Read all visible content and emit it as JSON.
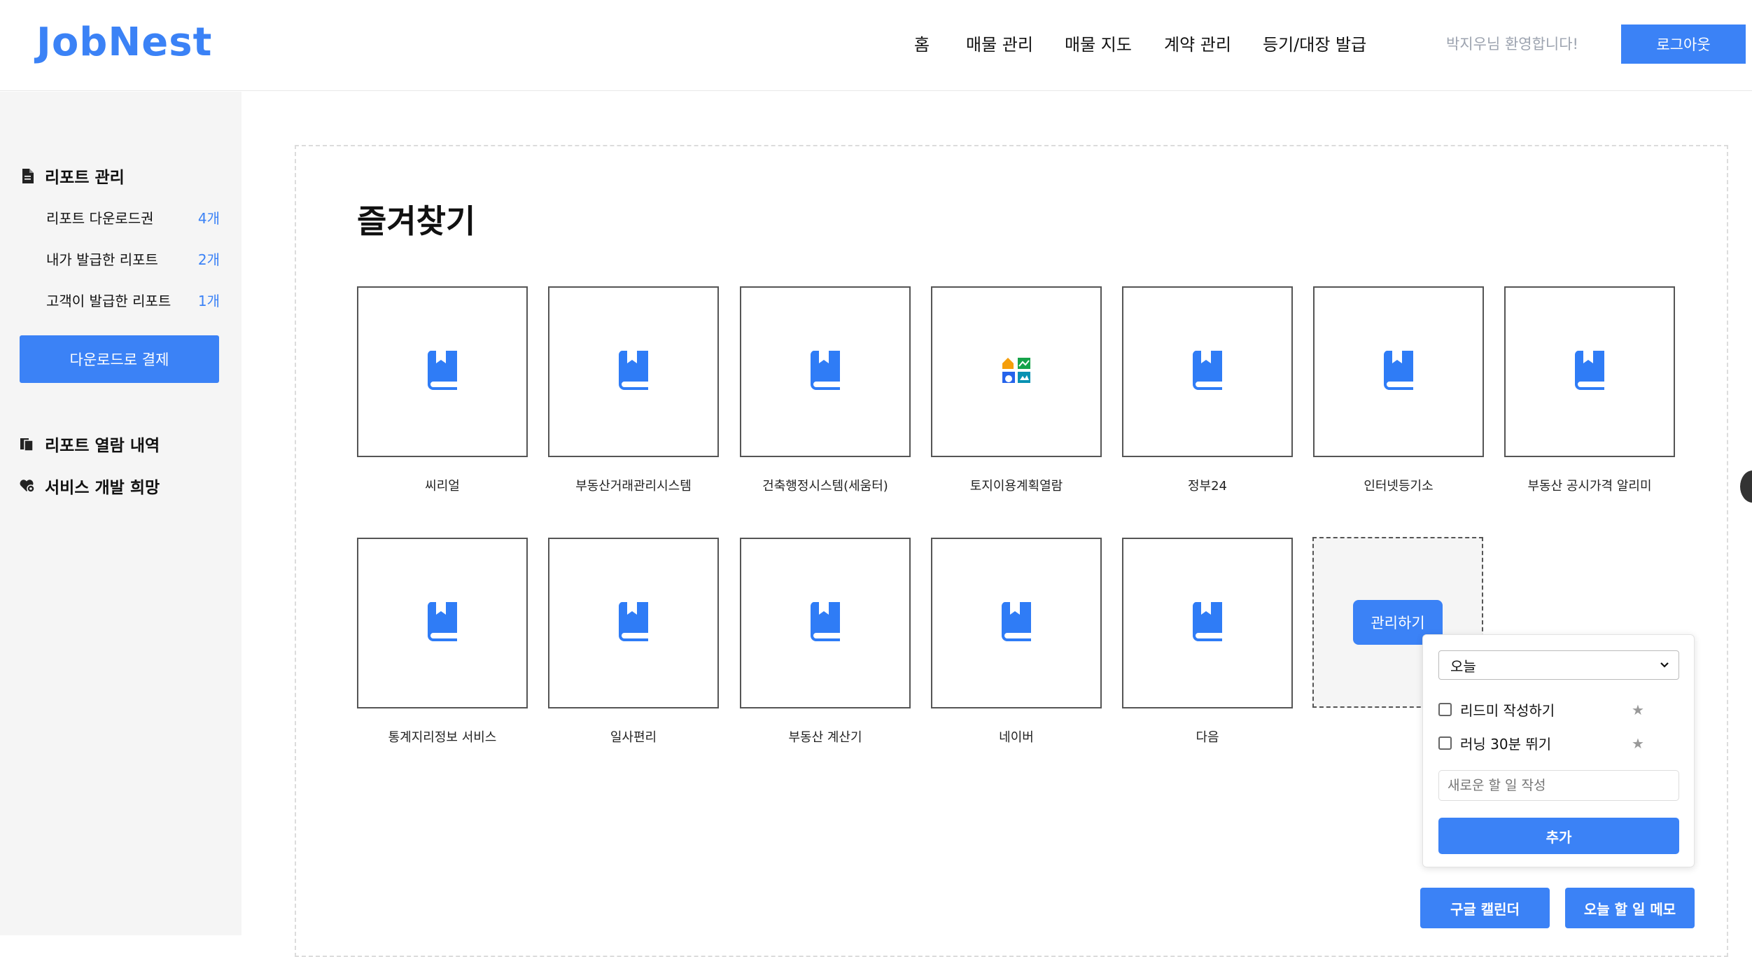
{
  "header": {
    "logo": "JobNest",
    "nav": [
      "홈",
      "매물 관리",
      "매물 지도",
      "계약 관리",
      "등기/대장 발급"
    ],
    "welcome": "박지우님 환영합니다!",
    "logout_label": "로그아웃"
  },
  "sidebar": {
    "report_manage": "리포트 관리",
    "items": [
      {
        "label": "리포트 다운로드권",
        "count": "4개"
      },
      {
        "label": "내가 발급한 리포트",
        "count": "2개"
      },
      {
        "label": "고객이 발급한 리포트",
        "count": "1개"
      }
    ],
    "download_button": "다운로드로 결제",
    "report_history": "리포트 열람 내역",
    "service_wish": "서비스 개발 희망"
  },
  "main": {
    "title": "즐겨찾기",
    "favorites": [
      {
        "label": "씨리얼",
        "icon": "bookmark-book-icon"
      },
      {
        "label": "부동산거래관리시스템",
        "icon": "bookmark-book-icon"
      },
      {
        "label": "건축행정시스템(세움터)",
        "icon": "bookmark-book-icon"
      },
      {
        "label": "토지이용계획열람",
        "icon": "land-use-logo-icon"
      },
      {
        "label": "정부24",
        "icon": "bookmark-book-icon"
      },
      {
        "label": "인터넷등기소",
        "icon": "bookmark-book-icon"
      },
      {
        "label": "부동산 공시가격 알리미",
        "icon": "bookmark-book-icon"
      },
      {
        "label": "통계지리정보 서비스",
        "icon": "bookmark-book-icon"
      },
      {
        "label": "일사편리",
        "icon": "bookmark-book-icon"
      },
      {
        "label": "부동산 계산기",
        "icon": "bookmark-book-icon"
      },
      {
        "label": "네이버",
        "icon": "bookmark-book-icon"
      },
      {
        "label": "다음",
        "icon": "bookmark-book-icon"
      }
    ],
    "manage_button": "관리하기"
  },
  "todo": {
    "select_value": "오늘",
    "items": [
      {
        "label": "리드미 작성하기",
        "checked": false
      },
      {
        "label": "러닝 30분 뛰기",
        "checked": false
      }
    ],
    "star_glyph": "★",
    "input_placeholder": "새로운 할 일 작성",
    "add_button": "추가"
  },
  "bottom_buttons": {
    "calendar": "구글 캘린더",
    "memo": "오늘 할 일 메모"
  },
  "colors": {
    "accent": "#3b82f6",
    "sidebar_bg": "#f5f5f5"
  }
}
